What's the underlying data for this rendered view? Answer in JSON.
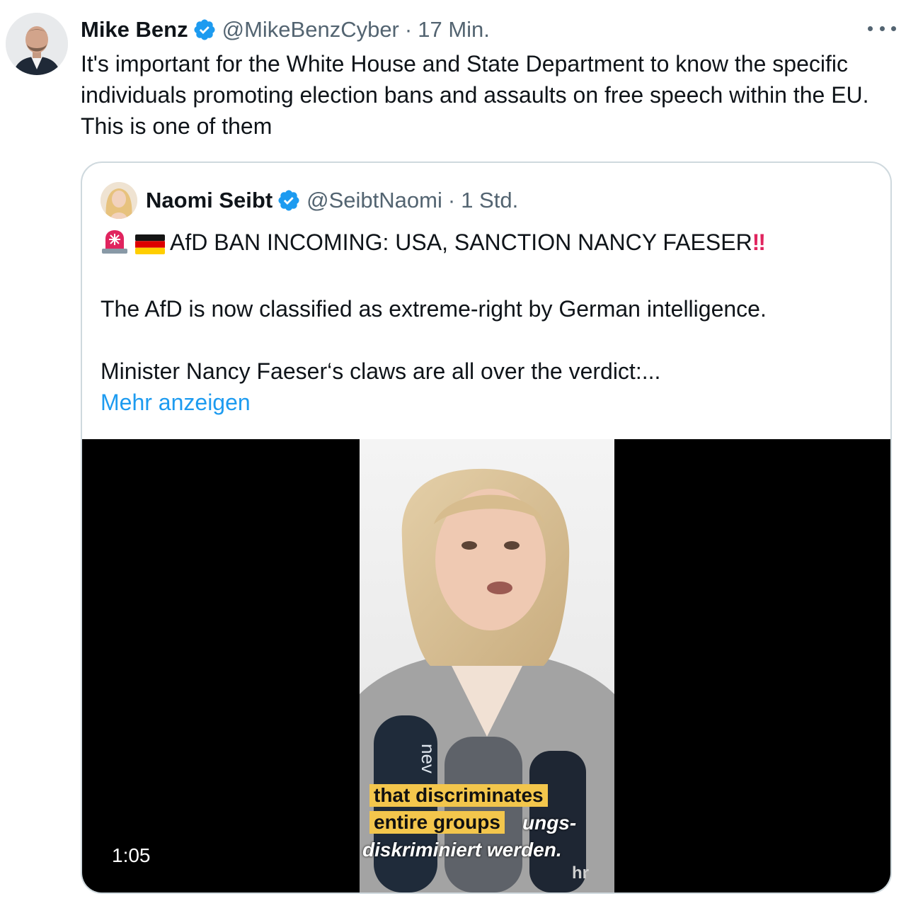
{
  "tweet": {
    "author_name": "Mike Benz",
    "handle": "@MikeBenzCyber",
    "separator": "·",
    "time": "17 Min.",
    "text": "It's important for the White House and State Department to know the specific individuals promoting election bans and assaults on free speech within the EU. This is one of them",
    "more_icon": "more-horizontal-icon",
    "verified_icon": "verified-badge-icon",
    "verified_color": "#1d9bf0"
  },
  "quote": {
    "author_name": "Naomi Seibt",
    "handle": "@SeibtNaomi",
    "separator": "·",
    "time": "1 Std.",
    "line1_text": "AfD BAN INCOMING: USA, SANCTION NANCY FAESER",
    "line1_icons": [
      "rotating-light-emoji",
      "germany-flag-emoji",
      "double-exclamation-emoji"
    ],
    "line1_bang": "‼",
    "line2": "The AfD is now classified as extreme-right by German intelligence.",
    "line3": "Minister Nancy Faeser‘s claws are all over the verdict:...",
    "show_more": "Mehr anzeigen",
    "link_color": "#1d9bf0"
  },
  "video": {
    "duration": "1:05",
    "subtitle_en_1": "that discriminates",
    "subtitle_en_2": "entire groups",
    "subtitle_de_1": "ungs-",
    "subtitle_de_2": "diskriminiert werden.",
    "mic_label": "nev",
    "channel_logo": "hr"
  }
}
